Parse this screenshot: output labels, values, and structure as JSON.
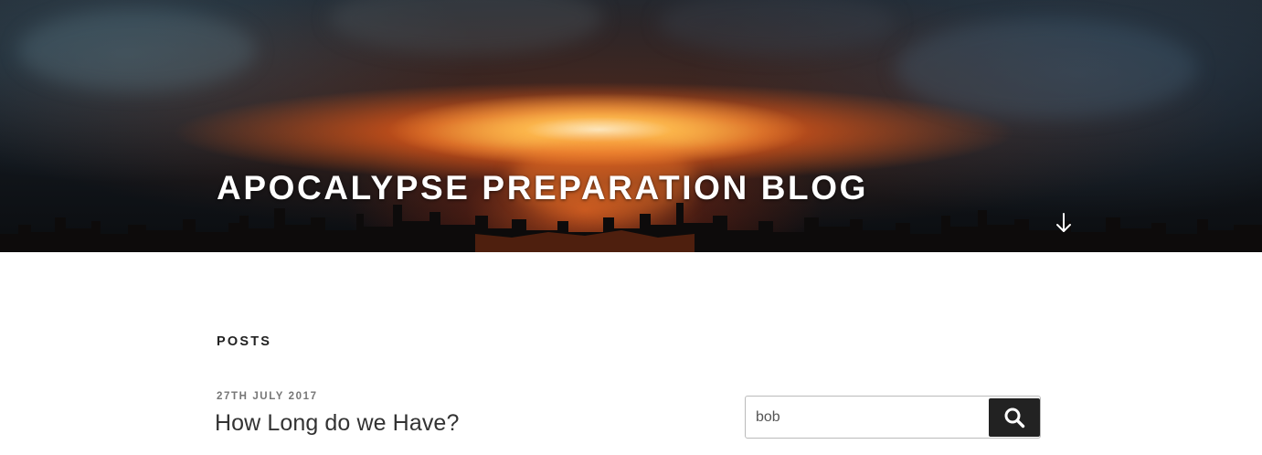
{
  "header": {
    "site_title": "APOCALYPSE PREPARATION BLOG",
    "scroll_icon": "arrow-down-icon",
    "background_image": "nuclear-explosion-over-city-skyline"
  },
  "main": {
    "section_heading": "POSTS",
    "posts": [
      {
        "date": "27TH JULY 2017",
        "title": "How Long do we Have?"
      }
    ]
  },
  "sidebar": {
    "search": {
      "value": "bob",
      "button_icon": "search-icon"
    }
  },
  "colors": {
    "title_text": "#ffffff",
    "heading_text": "#222222",
    "date_text": "#767676",
    "search_button_bg": "#222222"
  }
}
